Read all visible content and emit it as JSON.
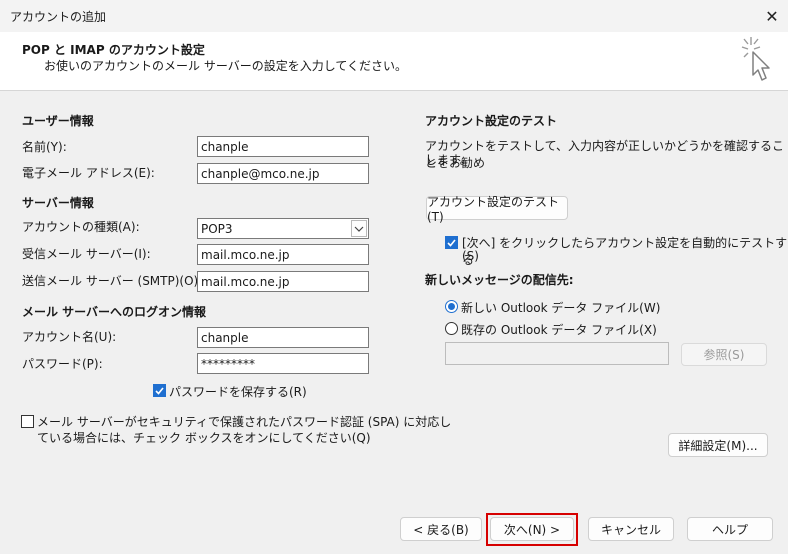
{
  "window": {
    "title": "アカウントの追加",
    "close_glyph": "✕"
  },
  "header": {
    "title": "POP と IMAP のアカウント設定",
    "subtitle": "お使いのアカウントのメール サーバーの設定を入力してください。"
  },
  "user_info": {
    "section": "ユーザー情報",
    "name_label": "名前(Y):",
    "name_value": "chanple",
    "email_label": "電子メール アドレス(E):",
    "email_value": "chanple@mco.ne.jp"
  },
  "server_info": {
    "section": "サーバー情報",
    "account_type_label": "アカウントの種類(A):",
    "account_type_value": "POP3",
    "incoming_label": "受信メール サーバー(I):",
    "incoming_value": "mail.mco.ne.jp",
    "outgoing_label": "送信メール サーバー (SMTP)(O):",
    "outgoing_value": "mail.mco.ne.jp"
  },
  "logon_info": {
    "section": "メール サーバーへのログオン情報",
    "account_name_label": "アカウント名(U):",
    "account_name_value": "chanple",
    "password_label": "パスワード(P):",
    "password_value": "*********",
    "remember_password_label": "パスワードを保存する(R)",
    "remember_password_checked": true,
    "spa_label_line1": "メール サーバーがセキュリティで保護されたパスワード認証 (SPA) に対応し",
    "spa_label_line2": "ている場合には、チェック ボックスをオンにしてください(Q)",
    "spa_checked": false
  },
  "test_settings": {
    "section": "アカウント設定のテスト",
    "description_line1": "アカウントをテストして、入力内容が正しいかどうかを確認することをお勧め",
    "description_line2": "します。",
    "test_button": "アカウント設定のテスト(T)",
    "auto_test_label_line1": "[次へ] をクリックしたらアカウント設定を自動的にテストする",
    "auto_test_label_line2": "(S)",
    "auto_test_checked": true
  },
  "delivery": {
    "section": "新しいメッセージの配信先:",
    "option_new": "新しい Outlook データ ファイル(W)",
    "option_existing": "既存の Outlook データ ファイル(X)",
    "selected": "new",
    "browse_button": "参照(S)"
  },
  "advanced_button": "詳細設定(M)...",
  "footer": {
    "back": "< 戻る(B)",
    "next": "次へ(N) >",
    "cancel": "キャンセル",
    "help": "ヘルプ"
  },
  "colors": {
    "accent": "#1f6fd0",
    "highlight": "#d60000"
  },
  "icons": {
    "close": "close-icon",
    "wizard": "cursor-sparkle-icon",
    "checkmark": "checkmark-icon",
    "dropdown": "chevron-down-icon"
  }
}
